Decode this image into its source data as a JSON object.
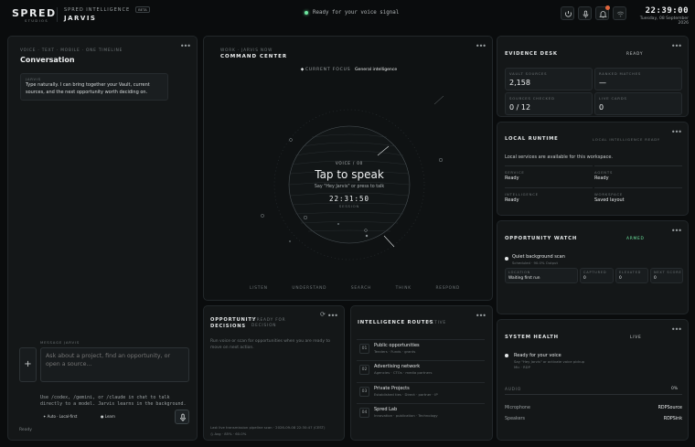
{
  "brand": {
    "logo": "SPRED",
    "logo_sub": "STUDIOS",
    "product": "SPRED INTELLIGENCE",
    "beta": "BETA",
    "name": "JARVIS"
  },
  "status": {
    "text": "Ready for your voice signal",
    "time": "22:39:00",
    "date": "Tuesday, 08 September 2026"
  },
  "conversation": {
    "crumb": "VOICE · TEXT · MOBILE · ONE TIMELINE",
    "title": "Conversation",
    "msg_author": "JARVIS",
    "msg_text": "Type naturally. I can bring together your Vault, current sources, and the next opportunity worth deciding on.",
    "input_label": "MESSAGE JARVIS",
    "input_placeholder": "Ask about a project, find an opportunity, or open a source...",
    "hint": "Use /codex, /gemini, or /claude in chat to talk directly to a model. Jarvis learns in the background.",
    "chip_auto": "Auto · Local-first",
    "chip_learn": "Learn",
    "status": "Ready"
  },
  "command": {
    "crumb": "WORK · JARVIS NOW",
    "title": "COMMAND CENTER",
    "focus_label": "CURRENT FOCUS",
    "focus_value": "General intelligence",
    "orb_label": "VOICE / 00",
    "orb_title": "Tap to speak",
    "orb_sub": "Say \"Hey Jarvis\" or press to talk",
    "orb_time": "22:31:50",
    "orb_time_label": "SESSION",
    "steps": [
      "LISTEN",
      "UNDERSTAND",
      "SEARCH",
      "THINK",
      "RESPOND"
    ]
  },
  "evidence": {
    "title": "EVIDENCE DESK",
    "badge": "READY",
    "cells": [
      {
        "label": "VAULT SOURCES",
        "value": "2,158"
      },
      {
        "label": "RANKED MATCHES",
        "value": "—"
      },
      {
        "label": "SOURCES CHECKED",
        "value": "0 / 12"
      },
      {
        "label": "LIVE CARDS",
        "value": "0"
      }
    ]
  },
  "runtime": {
    "title": "LOCAL RUNTIME",
    "badge": "LOCAL INTELLIGENCE READY",
    "desc": "Local services are available for this workspace.",
    "items": [
      {
        "label": "SERVICE",
        "value": "Ready"
      },
      {
        "label": "AGENTS",
        "value": "Ready"
      },
      {
        "label": "INTELLIGENCE",
        "value": "Ready"
      },
      {
        "label": "WORKSPACE",
        "value": "Saved layout"
      }
    ]
  },
  "watch": {
    "title": "OPPORTUNITY WATCH",
    "badge": "ARMED",
    "scan_title": "Quiet background scan",
    "scan_sub": "Scheduled · 90.0% Output",
    "cells": [
      {
        "label": "LOCATION",
        "value": "Waiting first run"
      },
      {
        "label": "CAPTURED",
        "value": "0"
      },
      {
        "label": "ELEVATED",
        "value": "0"
      },
      {
        "label": "NEXT SCORE",
        "value": "0"
      }
    ]
  },
  "health": {
    "title": "SYSTEM HEALTH",
    "badge": "LIVE",
    "voice_title": "Ready for your voice",
    "voice_sub": "Say \"Hey Jarvis\" or activate voice pickup",
    "voice_meta": "Mic · RDP",
    "audio_label": "AUDIO",
    "audio_value": "0%",
    "audio_level": 0,
    "mic_label": "Microphone",
    "mic_value": "RDPSource",
    "spk_label": "Speakers",
    "spk_value": "RDPSink"
  },
  "decisions": {
    "title": "OPPORTUNITY DECISIONS",
    "badge": "0 READY FOR DECISION",
    "empty": "Run voice or scan for opportunities when you are ready to move on next action.",
    "foot1": "Last live transmission pipeline scan · 2026-09-08 22:30:47 (CEST)",
    "foot2": "Avg · 85% · 60.0%"
  },
  "routes": {
    "title": "INTELLIGENCE ROUTES",
    "badge": "4 ACTIVE",
    "items": [
      {
        "num": "01",
        "name": "Public opportunities",
        "sub": "Tenders · Funds · grants"
      },
      {
        "num": "02",
        "name": "Advertising network",
        "sub": "Agencies · CTOs · media partners"
      },
      {
        "num": "03",
        "name": "Private Projects",
        "sub": "Established ties · Direct · partner · IP"
      },
      {
        "num": "04",
        "name": "Spred Lab",
        "sub": "Innovation · publication · Technology"
      }
    ]
  },
  "colors": {
    "accent": "#6ee7a0",
    "bg": "#0a0c0d",
    "panel": "#141718"
  }
}
